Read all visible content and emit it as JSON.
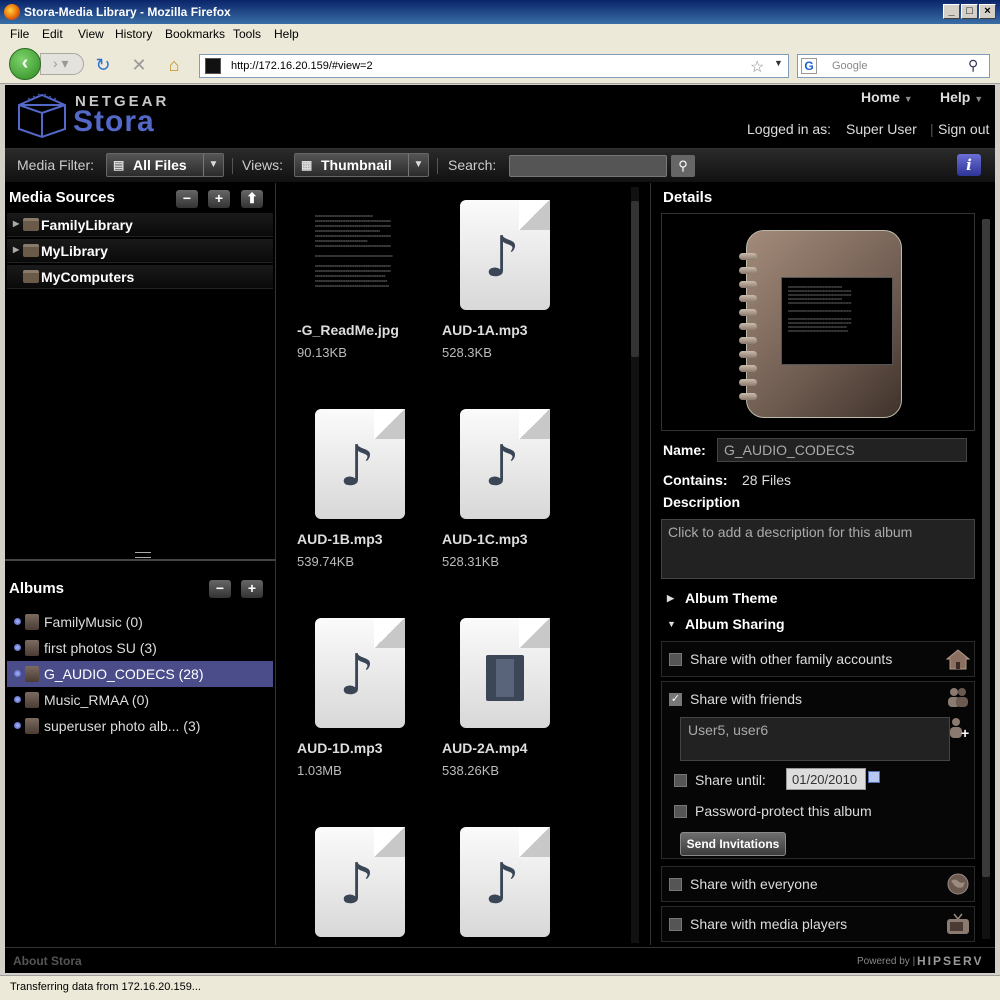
{
  "browser": {
    "window_title": "Stora-Media Library - Mozilla Firefox",
    "menu": [
      "File",
      "Edit",
      "View",
      "History",
      "Bookmarks",
      "Tools",
      "Help"
    ],
    "url": "http://172.16.20.159/#view=2",
    "search_placeholder": "Google",
    "status": "Transferring data from 172.16.20.159..."
  },
  "header": {
    "brand_top": "NETGEAR",
    "brand_main": "Stora",
    "home": "Home",
    "help": "Help",
    "logged_in_label": "Logged in as:",
    "user": "Super User",
    "sign_out": "Sign out"
  },
  "toolbar": {
    "media_filter_label": "Media Filter:",
    "media_filter_value": "All Files",
    "views_label": "Views:",
    "views_value": "Thumbnail",
    "search_label": "Search:"
  },
  "media_sources": {
    "title": "Media Sources",
    "items": [
      "FamilyLibrary",
      "MyLibrary",
      "MyComputers"
    ]
  },
  "albums": {
    "title": "Albums",
    "items": [
      "FamilyMusic (0)",
      "first photos SU (3)",
      "G_AUDIO_CODECS (28)",
      "Music_RMAA (0)",
      "superuser photo alb... (3)"
    ]
  },
  "files": [
    {
      "name": "-G_ReadMe.jpg",
      "size": "90.13KB",
      "kind": "image"
    },
    {
      "name": "AUD-1A.mp3",
      "size": "528.3KB",
      "kind": "audio"
    },
    {
      "name": "AUD-1B.mp3",
      "size": "539.74KB",
      "kind": "audio"
    },
    {
      "name": "AUD-1C.mp3",
      "size": "528.31KB",
      "kind": "audio"
    },
    {
      "name": "AUD-1D.mp3",
      "size": "1.03MB",
      "kind": "audio"
    },
    {
      "name": "AUD-2A.mp4",
      "size": "538.26KB",
      "kind": "video"
    },
    {
      "name": "",
      "size": "",
      "kind": "audio"
    },
    {
      "name": "",
      "size": "",
      "kind": "audio"
    }
  ],
  "details": {
    "title": "Details",
    "name_label": "Name:",
    "name_value": "G_AUDIO_CODECS",
    "contains_label": "Contains:",
    "contains_value": "28 Files",
    "description_label": "Description",
    "description_placeholder": "Click to add a description for this album",
    "album_theme": "Album Theme",
    "album_sharing": "Album Sharing",
    "share_family": "Share with other family accounts",
    "share_friends": "Share with friends",
    "friends_value": "User5, user6",
    "share_until": "Share until:",
    "share_until_date": "01/20/2010",
    "password_protect": "Password-protect this album",
    "send_invitations": "Send Invitations",
    "share_everyone": "Share with everyone",
    "share_players": "Share with media players"
  },
  "footer": {
    "about": "About Stora",
    "powered": "Powered by |",
    "hipserv": "HIPSERV"
  }
}
